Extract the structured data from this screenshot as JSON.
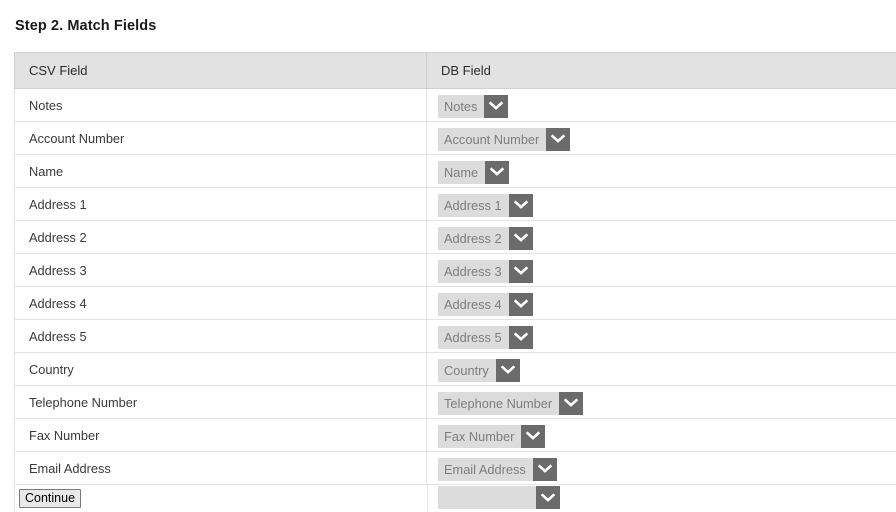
{
  "page": {
    "title": "Step 2. Match Fields"
  },
  "table": {
    "columns": [
      {
        "key": "csv",
        "label": "CSV Field"
      },
      {
        "key": "db",
        "label": "DB Field"
      }
    ],
    "rows": [
      {
        "csv": "Notes",
        "db": "Notes"
      },
      {
        "csv": "Account Number",
        "db": "Account Number"
      },
      {
        "csv": "Name",
        "db": "Name"
      },
      {
        "csv": "Address 1",
        "db": "Address 1"
      },
      {
        "csv": "Address 2",
        "db": "Address 2"
      },
      {
        "csv": "Address 3",
        "db": "Address 3"
      },
      {
        "csv": "Address 4",
        "db": "Address 4"
      },
      {
        "csv": "Address 5",
        "db": "Address 5"
      },
      {
        "csv": "Country",
        "db": "Country"
      },
      {
        "csv": "Telephone Number",
        "db": "Telephone Number"
      },
      {
        "csv": "Fax Number",
        "db": "Fax Number"
      },
      {
        "csv": "Email Address",
        "db": "Email Address"
      }
    ],
    "cut_off_row": {
      "csv": "",
      "db": ""
    }
  },
  "actions": {
    "continue_label": "Continue"
  },
  "icons": {
    "dropdown_arrow": "chevron-down-icon"
  },
  "colors": {
    "header_background": "#e2e2e2",
    "row_border": "#e3e3e3",
    "select_body": "#dcdcdc",
    "select_text": "#7d7d7d",
    "select_arrow_button": "#6b6b6b",
    "page_background": "#ffffff",
    "title_text": "#1a1a1a"
  }
}
